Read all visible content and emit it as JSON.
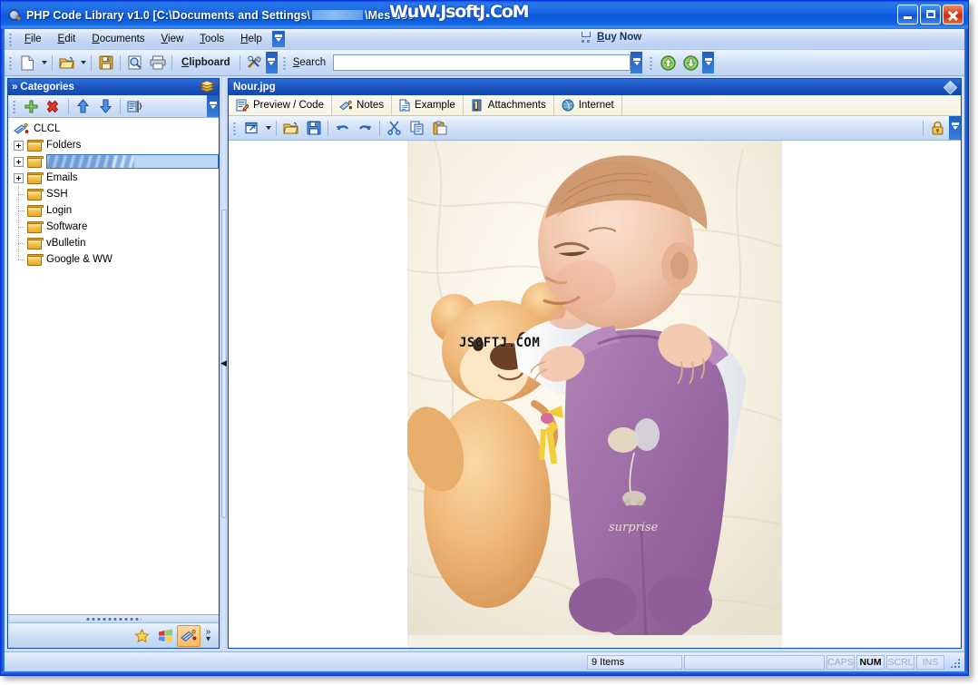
{
  "window": {
    "title_prefix": "PHP Code Library v1.0 [C:\\Documents and Settings\\",
    "title_suffix": "\\Mes doc",
    "watermark": "WuW.JsoftJ.CoM",
    "app_icon": "magnifier-icon",
    "minimize_label": "Minimize",
    "maximize_label": "Maximize",
    "close_label": "Close"
  },
  "menubar": {
    "items": [
      {
        "label": "File",
        "accel": "F"
      },
      {
        "label": "Edit",
        "accel": "E"
      },
      {
        "label": "Documents",
        "accel": "D"
      },
      {
        "label": "View",
        "accel": "V"
      },
      {
        "label": "Tools",
        "accel": "T"
      },
      {
        "label": "Help",
        "accel": "H"
      }
    ],
    "overflow_label": "More menu commands",
    "buy_now_label": "Buy Now"
  },
  "toolbar": {
    "new_label": "New",
    "new_icon": "new-document-icon",
    "open_label": "Open",
    "open_icon": "open-folder-icon",
    "save_label": "Save",
    "save_icon": "save-disk-icon",
    "print_preview_label": "Print Preview",
    "print_preview_icon": "print-preview-icon",
    "print_label": "Print",
    "print_icon": "printer-icon",
    "clipboard_label": "Clipboard",
    "clipboard_accel": "C",
    "tools_label": "Tools",
    "tools_icon": "hammer-wrench-icon",
    "overflow_label": "Toolbar Options",
    "search_label": "Search",
    "search_accel": "S",
    "search_value": "",
    "search_placeholder": "",
    "nav_prev_label": "Previous",
    "nav_prev_icon": "arrow-up-green-icon",
    "nav_next_label": "Next",
    "nav_next_icon": "arrow-down-green-icon"
  },
  "sidebar": {
    "title": "Categories",
    "chevron": "»",
    "header_icon": "books-icon",
    "toolbar": {
      "add_label": "Add Category",
      "add_icon": "plus-green-icon",
      "delete_label": "Delete Category",
      "delete_icon": "delete-red-x-icon",
      "move_up_label": "Move Up",
      "move_up_icon": "arrow-up-blue-icon",
      "move_down_label": "Move Down",
      "move_down_icon": "arrow-down-blue-icon",
      "properties_label": "Properties",
      "properties_icon": "properties-icon",
      "overflow_label": "Toolbar Options"
    },
    "tree": [
      {
        "label": "CLCL",
        "icon": "clcl-root-icon",
        "expandable": false,
        "level": 0,
        "selected": false,
        "redacted": false
      },
      {
        "label": "Folders",
        "icon": "folder-icon",
        "expandable": true,
        "level": 1,
        "selected": false,
        "redacted": false
      },
      {
        "label": "",
        "icon": "folder-icon",
        "expandable": true,
        "level": 1,
        "selected": true,
        "redacted": true
      },
      {
        "label": "Emails",
        "icon": "folder-icon",
        "expandable": true,
        "level": 1,
        "selected": false,
        "redacted": false
      },
      {
        "label": "SSH",
        "icon": "folder-icon",
        "expandable": false,
        "level": 1,
        "selected": false,
        "redacted": false
      },
      {
        "label": "Login",
        "icon": "folder-icon",
        "expandable": false,
        "level": 1,
        "selected": false,
        "redacted": false
      },
      {
        "label": "Software",
        "icon": "folder-icon",
        "expandable": false,
        "level": 1,
        "selected": false,
        "redacted": false
      },
      {
        "label": "vBulletin",
        "icon": "folder-icon",
        "expandable": false,
        "level": 1,
        "selected": false,
        "redacted": false
      },
      {
        "label": "Google & WW",
        "icon": "folder-icon",
        "expandable": false,
        "level": 1,
        "selected": false,
        "redacted": false
      }
    ],
    "footer": {
      "favorites_label": "Favorites",
      "favorites_icon": "star-yellow-icon",
      "windows_label": "Windows",
      "windows_icon": "windows-flag-icon",
      "clcl_label": "CLCL",
      "clcl_icon": "clcl-icon",
      "more_label": "More",
      "more_icon": "chevron-double-right-icon"
    }
  },
  "splitter": {
    "collapse_label": "Collapse panel",
    "collapse_icon": "chevron-left-icon"
  },
  "document": {
    "title": "Nour.jpg",
    "pin_icon": "diamond-icon",
    "tabs": [
      {
        "label": "Preview / Code",
        "icon": "preview-code-icon",
        "active": true
      },
      {
        "label": "Notes",
        "icon": "notes-icon",
        "active": false
      },
      {
        "label": "Example",
        "icon": "example-page-icon",
        "active": false
      },
      {
        "label": "Attachments",
        "icon": "paperclip-icon",
        "active": false
      },
      {
        "label": "Internet",
        "icon": "globe-icon",
        "active": false
      }
    ],
    "toolbar": {
      "external_label": "Open External",
      "external_icon": "open-external-icon",
      "dropdown_label": "Options",
      "dropdown_icon": "chevron-down-icon",
      "open_label": "Open",
      "open_icon": "open-folder-icon",
      "save_label": "Save",
      "save_icon": "save-disk-icon",
      "undo_label": "Undo",
      "undo_icon": "undo-arrow-icon",
      "redo_label": "Redo",
      "redo_icon": "redo-arrow-icon",
      "cut_label": "Cut",
      "cut_icon": "scissors-icon",
      "copy_label": "Copy",
      "copy_icon": "copy-icon",
      "paste_label": "Paste",
      "paste_icon": "paste-clipboard-icon",
      "lock_label": "Lock",
      "lock_icon": "padlock-icon",
      "overflow_label": "Toolbar Options"
    },
    "preview": {
      "image_name": "Nour.jpg",
      "image_alt": "Newborn baby in purple velour romper lying on white blanket next to a tan teddy bear",
      "watermark": "JSOFTJ.COM"
    }
  },
  "statusbar": {
    "item_count": "9 Items",
    "message": "",
    "keys": [
      {
        "label": "CAPS",
        "active": false
      },
      {
        "label": "NUM",
        "active": true
      },
      {
        "label": "SCRL",
        "active": false
      },
      {
        "label": "INS",
        "active": false
      }
    ],
    "resize_grip": "resize-grip-icon"
  },
  "colors": {
    "titlebar_blue": "#0f5ce2",
    "panel_header_blue": "#1a53c0",
    "close_red": "#d8421a",
    "selection_blue": "#7ba8e0",
    "tab_cream": "#f4f1dd",
    "folder_gold": "#f5c44e"
  }
}
